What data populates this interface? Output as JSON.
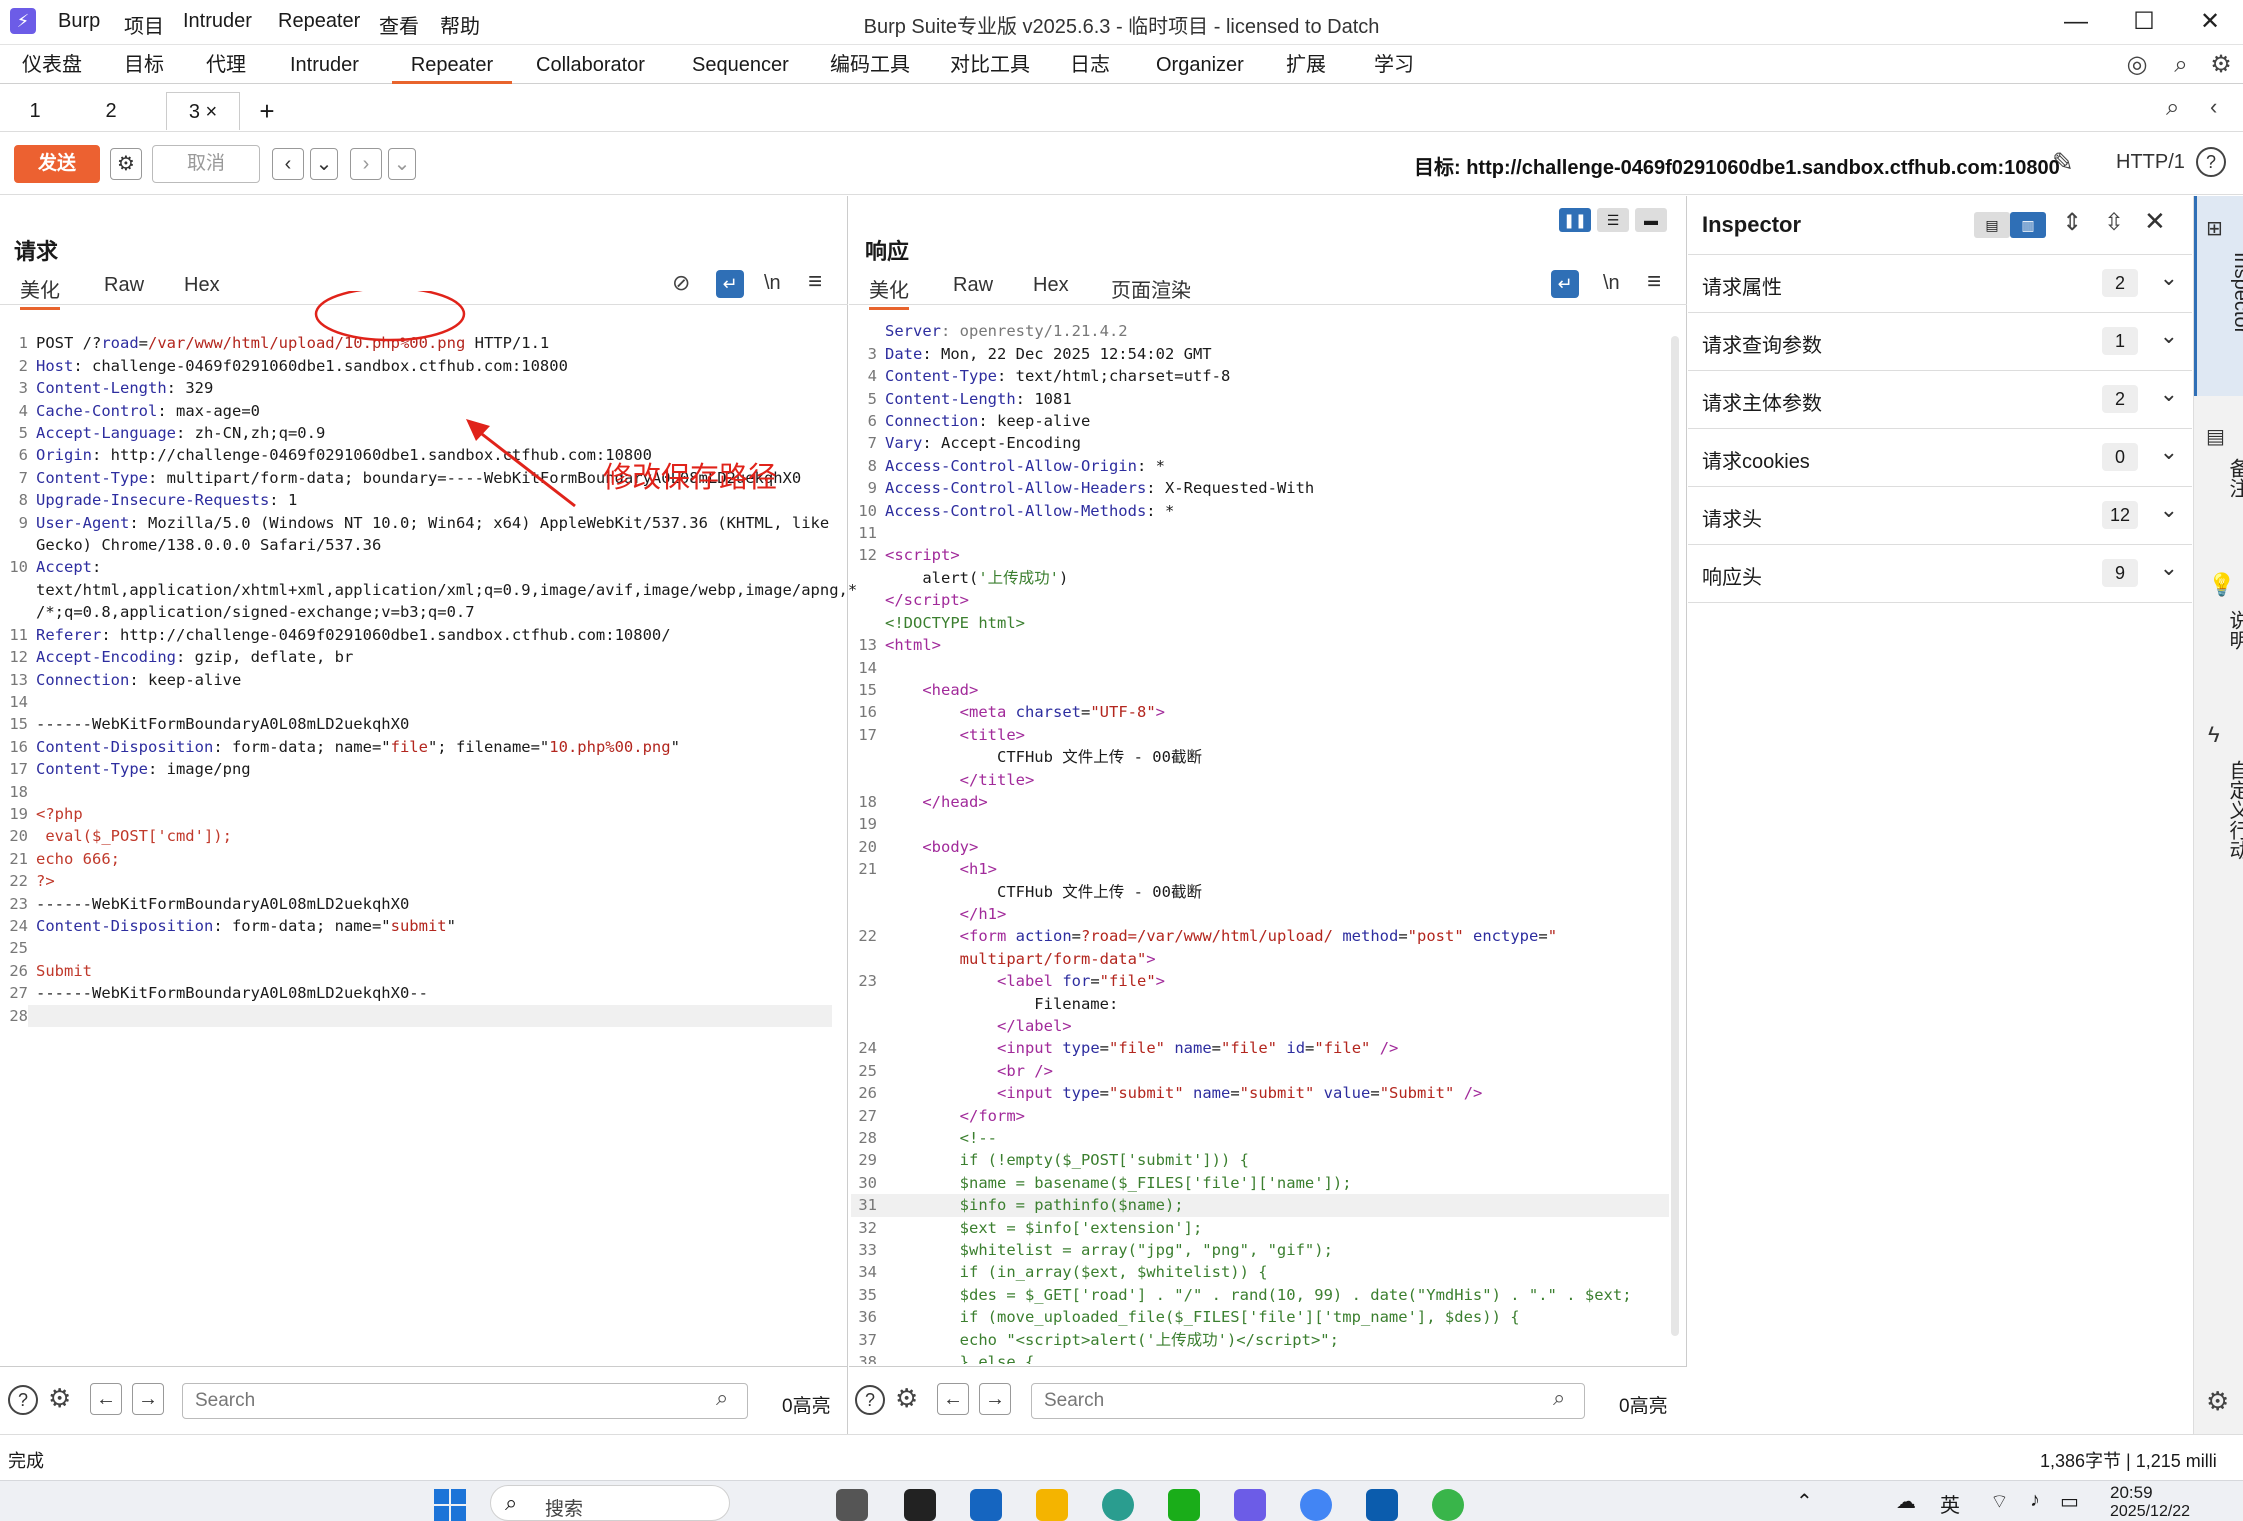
{
  "titlebar": {
    "logo": "⚡",
    "menus": [
      "Burp",
      "项目",
      "Intruder",
      "Repeater",
      "查看",
      "帮助"
    ],
    "title": "Burp Suite专业版  v2025.6.3 - 临时项目 - licensed to Datch",
    "controls": [
      "—",
      "☐",
      "✕"
    ]
  },
  "main_tabs": [
    "仪表盘",
    "目标",
    "代理",
    "Intruder",
    "Repeater",
    "Collaborator",
    "Sequencer",
    "编码工具",
    "对比工具",
    "日志",
    "Organizer",
    "扩展",
    "学习"
  ],
  "sub_tabs": [
    "1",
    "2",
    "3 ×"
  ],
  "add_tab": "+",
  "toolbar": {
    "send": "发送",
    "cancel": "取消",
    "target": "目标: http://challenge-0469f0291060dbe1.sandbox.ctfhub.com:10800",
    "http_version": "HTTP/1"
  },
  "request": {
    "title": "请求",
    "tabs": [
      "美化",
      "Raw",
      "Hex"
    ],
    "annotation": "修改保存路径",
    "line_numbers": [
      "1",
      "2",
      "3",
      "4",
      "5",
      "6",
      "7",
      "8",
      "9",
      "",
      "10",
      "",
      "",
      "11",
      "12",
      "13",
      "14",
      "15",
      "16",
      "17",
      "18",
      "19",
      "20",
      "21",
      "22",
      "23",
      "24",
      "25",
      "26",
      "27",
      "28"
    ],
    "search_placeholder": "Search",
    "highlights": "0高亮"
  },
  "response": {
    "title": "响应",
    "tabs": [
      "美化",
      "Raw",
      "Hex",
      "页面渲染"
    ],
    "search_placeholder": "Search",
    "highlights": "0高亮"
  },
  "inspector": {
    "title": "Inspector",
    "rows": [
      {
        "label": "请求属性",
        "count": "2"
      },
      {
        "label": "请求查询参数",
        "count": "1"
      },
      {
        "label": "请求主体参数",
        "count": "2"
      },
      {
        "label": "请求cookies",
        "count": "0"
      },
      {
        "label": "请求头",
        "count": "12"
      },
      {
        "label": "响应头",
        "count": "9"
      }
    ]
  },
  "side_tabs": [
    "Inspector",
    "备注",
    "说明",
    "自定义行动"
  ],
  "status": {
    "left": "完成",
    "right": "1,386字节 | 1,215 milli"
  },
  "taskbar": {
    "search": "搜索",
    "ime": "英",
    "time": "20:59",
    "date": "2025/12/22"
  }
}
